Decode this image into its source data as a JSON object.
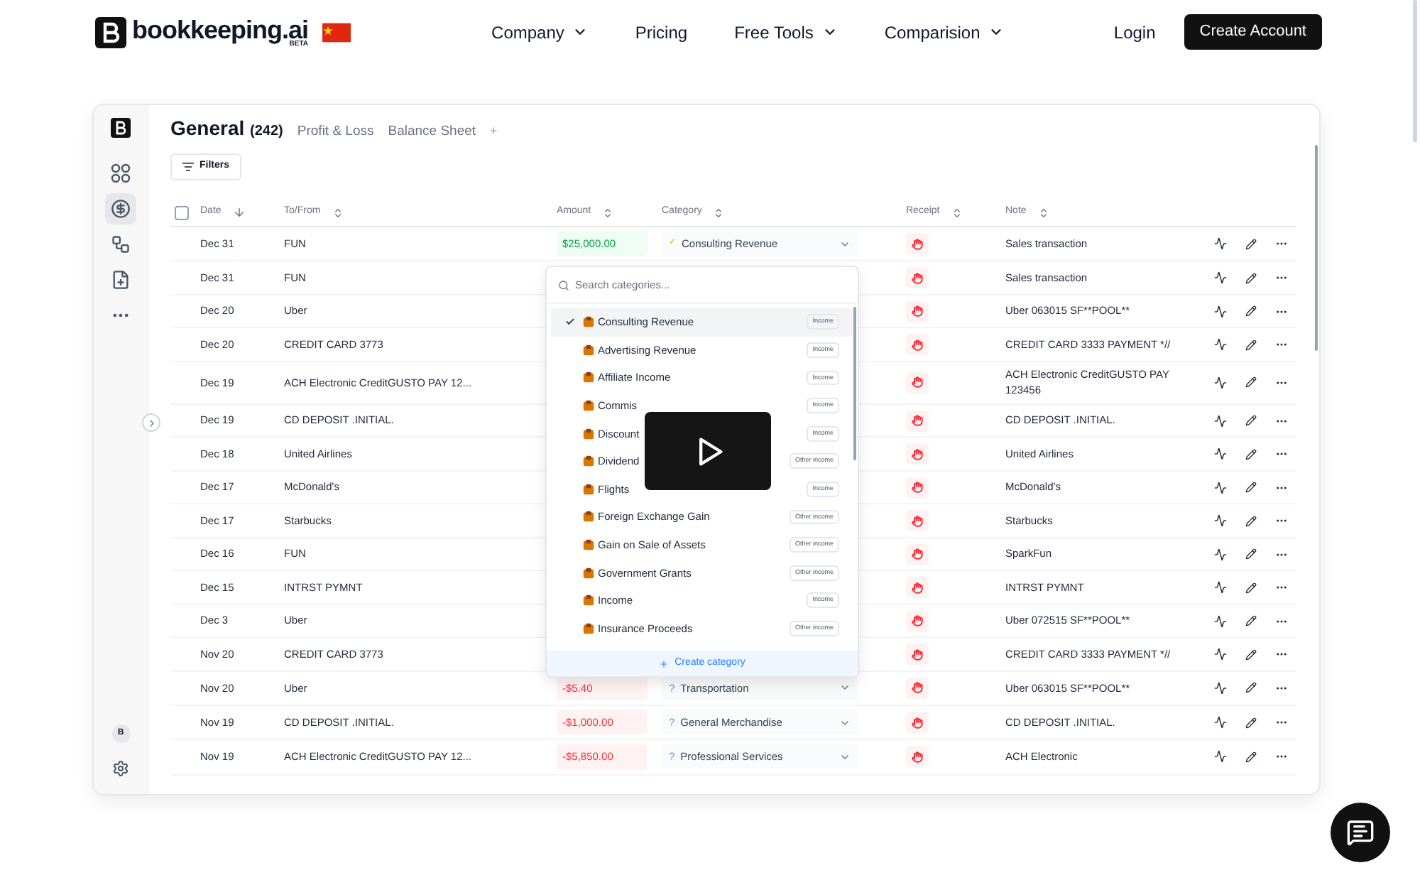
{
  "nav": {
    "logo": "bookkeeping.ai",
    "badge": "BETA",
    "links": [
      {
        "label": "Company",
        "dropdown": true
      },
      {
        "label": "Pricing",
        "dropdown": false
      },
      {
        "label": "Free Tools",
        "dropdown": true
      },
      {
        "label": "Comparision",
        "dropdown": true
      }
    ],
    "login": "Login",
    "cta": "Create Account"
  },
  "sidebar": {
    "items": [
      {
        "kind": "grid",
        "selected": false
      },
      {
        "kind": "dollar",
        "selected": true
      },
      {
        "kind": "nodes",
        "selected": false
      },
      {
        "kind": "file",
        "selected": false
      },
      {
        "kind": "more",
        "selected": false
      }
    ],
    "avatar": "B"
  },
  "header": {
    "title": "General",
    "count": "(242)",
    "tabs": [
      "Profit & Loss",
      "Balance Sheet"
    ],
    "add": "+"
  },
  "filters": "Filters",
  "select_all": {
    "checked": false
  },
  "columns": [
    {
      "label": "Date",
      "sorted": true
    },
    {
      "label": "To/From",
      "sorted": false
    },
    {
      "label": "Amount",
      "sorted": false
    },
    {
      "label": "Category",
      "sorted": false
    },
    {
      "label": "Receipt",
      "sorted": false
    },
    {
      "label": "Note",
      "sorted": false
    }
  ],
  "rows": [
    {
      "date": "Dec 31",
      "to_from": "FUN",
      "amount": {
        "text": "$25,000.00",
        "kind": "income"
      },
      "category": {
        "mark": "✓",
        "label": "Consulting Revenue",
        "confirmed": true
      },
      "note": "Sales transaction"
    },
    {
      "date": "Dec 31",
      "to_from": "FUN",
      "note": "Sales transaction"
    },
    {
      "date": "Dec 20",
      "to_from": "Uber",
      "note": "Uber 063015 SF**POOL**"
    },
    {
      "date": "Dec 20",
      "to_from": "CREDIT CARD 3773",
      "note": "CREDIT CARD 3333 PAYMENT *//"
    },
    {
      "date": "Dec 19",
      "to_from": "ACH Electronic CreditGUSTO PAY 12...",
      "note": "ACH Electronic CreditGUSTO PAY 123456"
    },
    {
      "date": "Dec 19",
      "to_from": "CD DEPOSIT .INITIAL.",
      "note": "CD DEPOSIT .INITIAL."
    },
    {
      "date": "Dec 18",
      "to_from": "United Airlines",
      "note": "United Airlines"
    },
    {
      "date": "Dec 17",
      "to_from": "McDonald's",
      "note": "McDonald's"
    },
    {
      "date": "Dec 17",
      "to_from": "Starbucks",
      "note": "Starbucks"
    },
    {
      "date": "Dec 16",
      "to_from": "FUN",
      "note": "SparkFun"
    },
    {
      "date": "Dec 15",
      "to_from": "INTRST PYMNT",
      "note": "INTRST PYMNT"
    },
    {
      "date": "Dec 3",
      "to_from": "Uber",
      "note": "Uber 072515 SF**POOL**"
    },
    {
      "date": "Nov 20",
      "to_from": "CREDIT CARD 3773",
      "note": "CREDIT CARD 3333 PAYMENT *//"
    },
    {
      "date": "Nov 20",
      "to_from": "Uber",
      "amount": {
        "text": "-$5.40",
        "kind": "expense"
      },
      "category": {
        "mark": "?",
        "label": "Transportation",
        "confirmed": false
      },
      "note": "Uber 063015 SF**POOL**"
    },
    {
      "date": "Nov 19",
      "to_from": "CD DEPOSIT .INITIAL.",
      "amount": {
        "text": "-$1,000.00",
        "kind": "expense"
      },
      "category": {
        "mark": "?",
        "label": "General Merchandise",
        "confirmed": false
      },
      "note": "CD DEPOSIT .INITIAL."
    },
    {
      "date": "Nov 19",
      "to_from": "ACH Electronic CreditGUSTO PAY 12...",
      "amount": {
        "text": "-$5,850.00",
        "kind": "expense"
      },
      "category": {
        "mark": "?",
        "label": "Professional Services",
        "confirmed": false
      },
      "note": "ACH Electronic"
    }
  ],
  "dropdown": {
    "placeholder": "Search categories...",
    "items": [
      {
        "label": "Consulting Revenue",
        "tag": "Income",
        "selected": true
      },
      {
        "label": "Advertising Revenue",
        "tag": "Income",
        "selected": false
      },
      {
        "label": "Affiliate Income",
        "tag": "Income",
        "selected": false
      },
      {
        "label": "Commis",
        "tag": "Income",
        "selected": false
      },
      {
        "label": "Discount",
        "tag": "Income",
        "selected": false
      },
      {
        "label": "Dividend",
        "tag": "Other income",
        "selected": false
      },
      {
        "label": "Flights",
        "tag": "Income",
        "selected": false
      },
      {
        "label": "Foreign Exchange Gain",
        "tag": "Other income",
        "selected": false
      },
      {
        "label": "Gain on Sale of Assets",
        "tag": "Other income",
        "selected": false
      },
      {
        "label": "Government Grants",
        "tag": "Other income",
        "selected": false
      },
      {
        "label": "Income",
        "tag": "Income",
        "selected": false
      },
      {
        "label": "Insurance Proceeds",
        "tag": "Other income",
        "selected": false
      }
    ],
    "create": "Create category"
  }
}
